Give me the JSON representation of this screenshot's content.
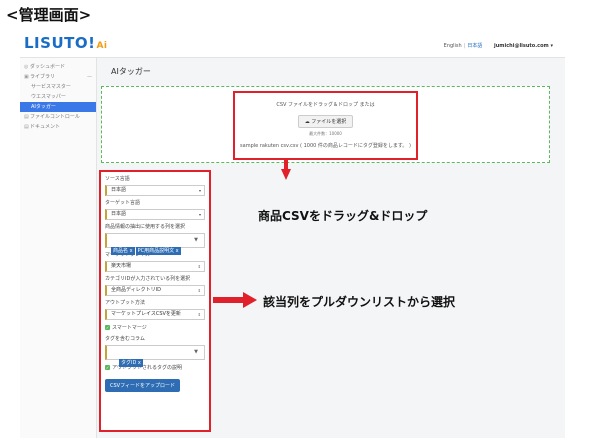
{
  "caption": "<管理画面>",
  "header": {
    "logo_text": "LISUTO!",
    "logo_ai": "Ai",
    "lang_en": "English",
    "lang_sep": "|",
    "lang_ja": "日本語",
    "user": "jumichi@lisuto.com ▾"
  },
  "sidebar": {
    "items": [
      {
        "icon": "◎",
        "label": "ダッシュボード"
      },
      {
        "icon": "▣",
        "label": "ライブラリ",
        "chevron": "—"
      },
      {
        "label": "サービスマスター"
      },
      {
        "label": "ウエスマッパー"
      },
      {
        "label": "AIタッガー"
      },
      {
        "icon": "▤",
        "label": "ファイルコントロール"
      },
      {
        "icon": "▤",
        "label": "ドキュメント"
      }
    ]
  },
  "main": {
    "title": "AIタッガー",
    "dropzone": {
      "text": "CSV ファイルをドラッグ＆ドロップ または",
      "button": "☁ ファイルを選択",
      "max": "最大件数：10000",
      "sample": "sample rakuten csv.csv ( 1000 件の商品レコードにタグ登録をします。 )"
    },
    "form": {
      "source_lang_label": "ソース言語",
      "source_lang_value": "日本語",
      "target_lang_label": "ターゲット言語",
      "target_lang_value": "日本語",
      "columns_label": "商品情報の抽出に使用する列を選択",
      "columns_tags": [
        "商品名 x",
        "PC用商品説明文 x"
      ],
      "marketplace_label": "マーケットプレイス",
      "marketplace_value": "楽天市場",
      "category_label": "カテゴリIDが入力されている列を選択",
      "category_value": "全商品ディレクトリID",
      "output_label": "アウトプット方法",
      "output_value": "マーケットプレイスCSVを更新",
      "smart_merge": "スマートマージ",
      "tag_column_label": "タグを含むコラム",
      "tag_column_tags": [
        "タグID x"
      ],
      "output_desc": "アウトプットされるタグの説明",
      "upload_button": "CSVフィードをアップロード"
    }
  },
  "annotations": {
    "drag_drop": "商品CSVをドラッグ&ドロップ",
    "select_column": "該当列をプルダウンリストから選択"
  },
  "colors": {
    "highlight_red": "#e0202a",
    "brand_blue": "#1a6dc4",
    "dropzone_green": "#5cb85c"
  }
}
